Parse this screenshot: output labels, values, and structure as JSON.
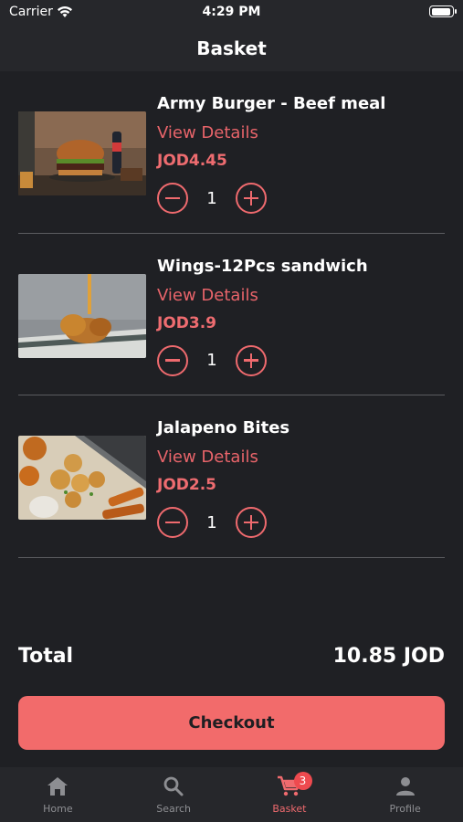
{
  "status_bar": {
    "carrier": "Carrier",
    "time": "4:29 PM"
  },
  "header": {
    "title": "Basket"
  },
  "items": [
    {
      "name": "Army Burger - Beef meal",
      "details_label": "View Details",
      "price": "JOD4.45",
      "quantity": "1",
      "image": "burger-photo"
    },
    {
      "name": "Wings-12Pcs sandwich",
      "details_label": "View Details",
      "price": "JOD3.9",
      "quantity": "1",
      "image": "wings-photo"
    },
    {
      "name": "Jalapeno Bites",
      "details_label": "View Details",
      "price": "JOD2.5",
      "quantity": "1",
      "image": "jalapeno-bites-photo"
    }
  ],
  "summary": {
    "total_label": "Total",
    "total_value": "10.85 JOD"
  },
  "checkout": {
    "label": "Checkout"
  },
  "tabs": [
    {
      "label": "Home",
      "icon": "home-icon"
    },
    {
      "label": "Search",
      "icon": "search-icon"
    },
    {
      "label": "Basket",
      "icon": "cart-icon",
      "badge": "3",
      "active": true
    },
    {
      "label": "Profile",
      "icon": "profile-icon"
    }
  ],
  "colors": {
    "accent": "#f26b6b",
    "background": "#1f2024",
    "bar": "#26272b"
  }
}
